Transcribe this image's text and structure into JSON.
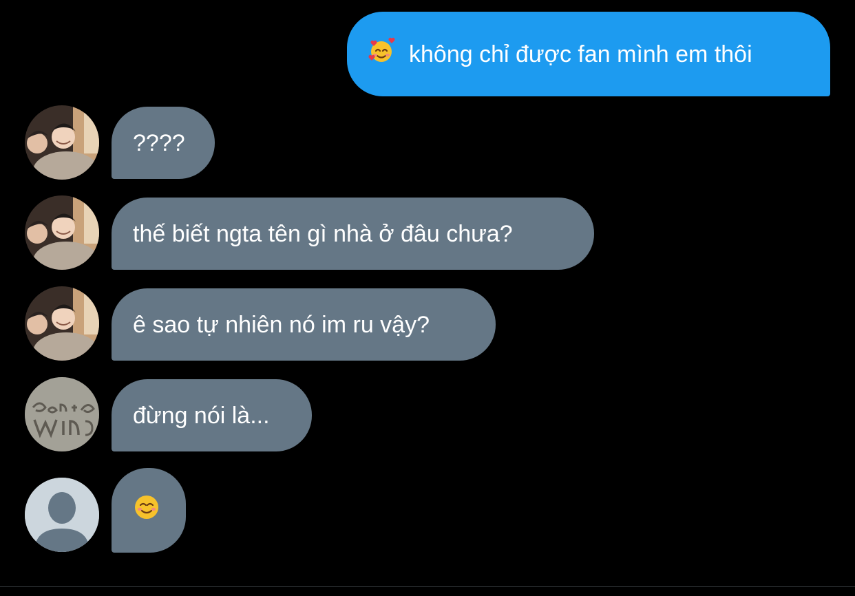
{
  "conversation": {
    "messages": [
      {
        "direction": "outgoing",
        "emoji_icon": "smiling-face-with-hearts-icon",
        "text": "không chỉ được fan mình em thôi"
      },
      {
        "direction": "incoming",
        "avatar": "user-photo-avatar",
        "text": "????"
      },
      {
        "direction": "incoming",
        "avatar": "user-photo-avatar",
        "text": "thế biết ngta tên gì nhà ở đâu chưa?"
      },
      {
        "direction": "incoming",
        "avatar": "user-photo-avatar",
        "text": "ê sao tự nhiên nó im ru vậy?"
      },
      {
        "direction": "incoming",
        "avatar": "sand-writing-avatar",
        "text": "đừng nói là..."
      },
      {
        "direction": "incoming",
        "avatar": "default-profile-avatar",
        "emoji_icon": "smiling-face-icon"
      }
    ]
  },
  "colors": {
    "background": "#000000",
    "outgoing_bubble": "#1d9bf0",
    "incoming_bubble": "#657786",
    "text": "#ffffff",
    "default_avatar_bg": "#ccd6dd",
    "default_avatar_figure": "#657786"
  }
}
